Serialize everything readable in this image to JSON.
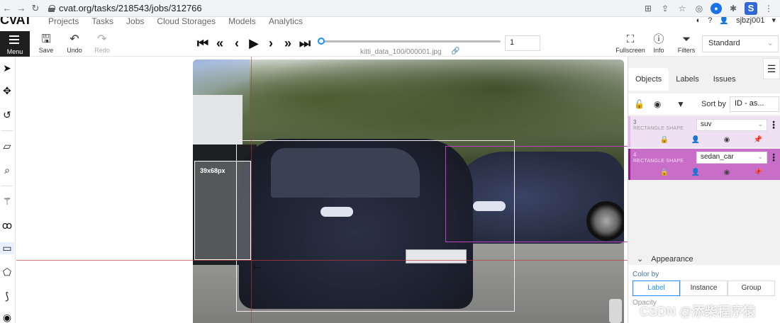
{
  "browser": {
    "url": "cvat.org/tasks/218543/jobs/312766"
  },
  "cvat_nav": {
    "logo": "CVAT",
    "items": [
      "Projects",
      "Tasks",
      "Jobs",
      "Cloud Storages",
      "Models",
      "Analytics"
    ],
    "user": "sjbzj001"
  },
  "toolbar": {
    "menu_label": "Menu",
    "save_label": "Save",
    "undo_label": "Undo",
    "redo_label": "Redo",
    "filename": "kitti_data_100/000001.jpg",
    "frame_number": "1",
    "fullscreen_label": "Fullscreen",
    "info_label": "Info",
    "filters_label": "Filters",
    "workspace": "Standard"
  },
  "canvas": {
    "size_label": "39x68px"
  },
  "right_panel": {
    "tabs": [
      "Objects",
      "Labels",
      "Issues"
    ],
    "sort_by_label": "Sort by",
    "sort_value": "ID - as...",
    "objects": [
      {
        "id": "3",
        "type": "RECTANGLE SHAPE",
        "label": "suv"
      },
      {
        "id": "4",
        "type": "RECTANGLE SHAPE",
        "label": "sedan_car"
      }
    ],
    "appearance_title": "Appearance",
    "color_by_label": "Color by",
    "color_by_options": [
      "Label",
      "Instance",
      "Group"
    ],
    "opacity_label": "Opacity"
  },
  "watermark": "CSDN @添柴程序猿",
  "colors": {
    "accent": "#1890ff",
    "sedan_car": "#c86dc8",
    "suv": "#f0e0f4",
    "crosshair": "#c0393b"
  }
}
